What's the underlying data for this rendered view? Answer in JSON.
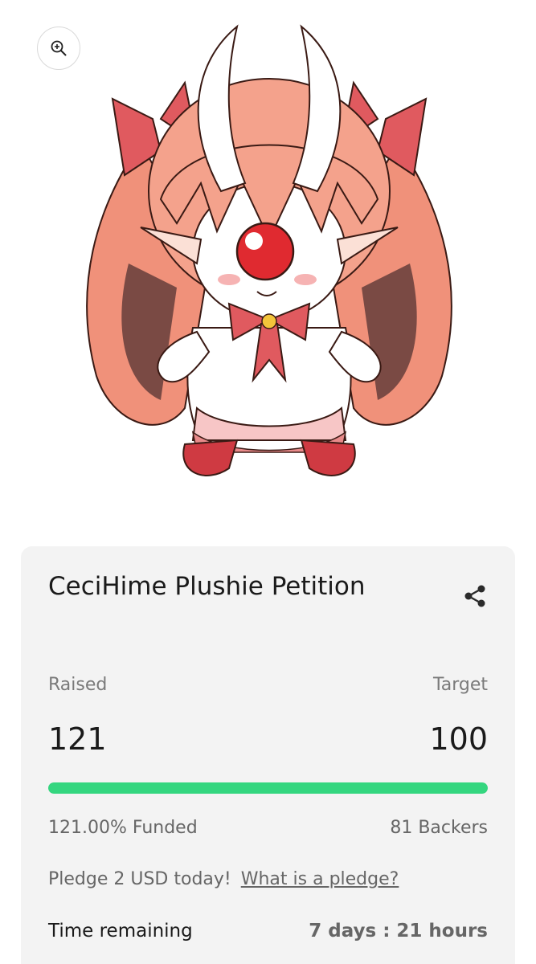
{
  "hero": {
    "zoom_icon": "zoom-in-icon",
    "image_alt": "CeciHime plushie illustration"
  },
  "campaign": {
    "title": "CeciHime Plushie Petition",
    "share_icon": "share-icon",
    "raised_label": "Raised",
    "target_label": "Target",
    "raised_value": "121",
    "target_value": "100",
    "progress_fraction": 1.0,
    "progress_color": "#34d67f",
    "funded_text": "121.00% Funded",
    "backers_text": "81 Backers",
    "pledge_text": "Pledge 2 USD today!",
    "pledge_link": "What is a pledge?",
    "time_label": "Time remaining",
    "time_value": "7 days : 21 hours"
  }
}
